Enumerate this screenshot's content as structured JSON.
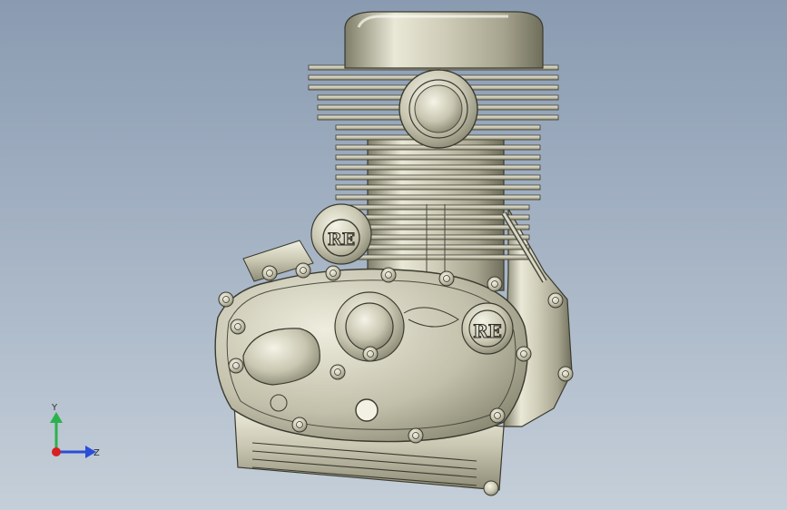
{
  "viewport": {
    "background_top": "#8a9bb1",
    "background_bottom": "#c5cfd9"
  },
  "model": {
    "logo_text": "RE",
    "body_color": "#d9d8c4",
    "shade_color": "#8f8e78",
    "edge_color": "#3a3a30"
  },
  "triad": {
    "y_label": "Y",
    "z_label": "Z",
    "y_color": "#2bb24c",
    "z_color": "#2a4ed8",
    "x_color": "#d92020"
  }
}
